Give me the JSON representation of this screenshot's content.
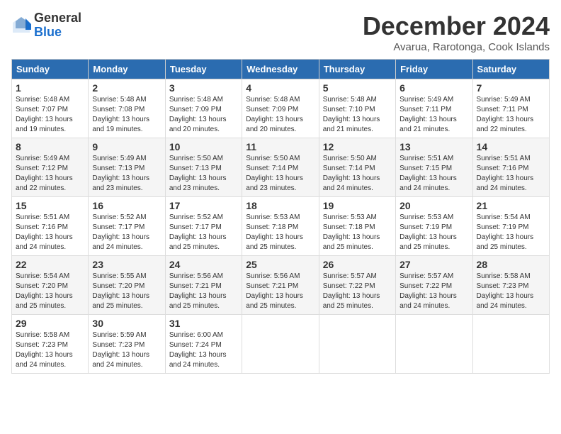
{
  "logo": {
    "general": "General",
    "blue": "Blue"
  },
  "title": "December 2024",
  "subtitle": "Avarua, Rarotonga, Cook Islands",
  "headers": [
    "Sunday",
    "Monday",
    "Tuesday",
    "Wednesday",
    "Thursday",
    "Friday",
    "Saturday"
  ],
  "weeks": [
    [
      {
        "day": "1",
        "info": "Sunrise: 5:48 AM\nSunset: 7:07 PM\nDaylight: 13 hours\nand 19 minutes."
      },
      {
        "day": "2",
        "info": "Sunrise: 5:48 AM\nSunset: 7:08 PM\nDaylight: 13 hours\nand 19 minutes."
      },
      {
        "day": "3",
        "info": "Sunrise: 5:48 AM\nSunset: 7:09 PM\nDaylight: 13 hours\nand 20 minutes."
      },
      {
        "day": "4",
        "info": "Sunrise: 5:48 AM\nSunset: 7:09 PM\nDaylight: 13 hours\nand 20 minutes."
      },
      {
        "day": "5",
        "info": "Sunrise: 5:48 AM\nSunset: 7:10 PM\nDaylight: 13 hours\nand 21 minutes."
      },
      {
        "day": "6",
        "info": "Sunrise: 5:49 AM\nSunset: 7:11 PM\nDaylight: 13 hours\nand 21 minutes."
      },
      {
        "day": "7",
        "info": "Sunrise: 5:49 AM\nSunset: 7:11 PM\nDaylight: 13 hours\nand 22 minutes."
      }
    ],
    [
      {
        "day": "8",
        "info": "Sunrise: 5:49 AM\nSunset: 7:12 PM\nDaylight: 13 hours\nand 22 minutes."
      },
      {
        "day": "9",
        "info": "Sunrise: 5:49 AM\nSunset: 7:13 PM\nDaylight: 13 hours\nand 23 minutes."
      },
      {
        "day": "10",
        "info": "Sunrise: 5:50 AM\nSunset: 7:13 PM\nDaylight: 13 hours\nand 23 minutes."
      },
      {
        "day": "11",
        "info": "Sunrise: 5:50 AM\nSunset: 7:14 PM\nDaylight: 13 hours\nand 23 minutes."
      },
      {
        "day": "12",
        "info": "Sunrise: 5:50 AM\nSunset: 7:14 PM\nDaylight: 13 hours\nand 24 minutes."
      },
      {
        "day": "13",
        "info": "Sunrise: 5:51 AM\nSunset: 7:15 PM\nDaylight: 13 hours\nand 24 minutes."
      },
      {
        "day": "14",
        "info": "Sunrise: 5:51 AM\nSunset: 7:16 PM\nDaylight: 13 hours\nand 24 minutes."
      }
    ],
    [
      {
        "day": "15",
        "info": "Sunrise: 5:51 AM\nSunset: 7:16 PM\nDaylight: 13 hours\nand 24 minutes."
      },
      {
        "day": "16",
        "info": "Sunrise: 5:52 AM\nSunset: 7:17 PM\nDaylight: 13 hours\nand 24 minutes."
      },
      {
        "day": "17",
        "info": "Sunrise: 5:52 AM\nSunset: 7:17 PM\nDaylight: 13 hours\nand 25 minutes."
      },
      {
        "day": "18",
        "info": "Sunrise: 5:53 AM\nSunset: 7:18 PM\nDaylight: 13 hours\nand 25 minutes."
      },
      {
        "day": "19",
        "info": "Sunrise: 5:53 AM\nSunset: 7:18 PM\nDaylight: 13 hours\nand 25 minutes."
      },
      {
        "day": "20",
        "info": "Sunrise: 5:53 AM\nSunset: 7:19 PM\nDaylight: 13 hours\nand 25 minutes."
      },
      {
        "day": "21",
        "info": "Sunrise: 5:54 AM\nSunset: 7:19 PM\nDaylight: 13 hours\nand 25 minutes."
      }
    ],
    [
      {
        "day": "22",
        "info": "Sunrise: 5:54 AM\nSunset: 7:20 PM\nDaylight: 13 hours\nand 25 minutes."
      },
      {
        "day": "23",
        "info": "Sunrise: 5:55 AM\nSunset: 7:20 PM\nDaylight: 13 hours\nand 25 minutes."
      },
      {
        "day": "24",
        "info": "Sunrise: 5:56 AM\nSunset: 7:21 PM\nDaylight: 13 hours\nand 25 minutes."
      },
      {
        "day": "25",
        "info": "Sunrise: 5:56 AM\nSunset: 7:21 PM\nDaylight: 13 hours\nand 25 minutes."
      },
      {
        "day": "26",
        "info": "Sunrise: 5:57 AM\nSunset: 7:22 PM\nDaylight: 13 hours\nand 25 minutes."
      },
      {
        "day": "27",
        "info": "Sunrise: 5:57 AM\nSunset: 7:22 PM\nDaylight: 13 hours\nand 24 minutes."
      },
      {
        "day": "28",
        "info": "Sunrise: 5:58 AM\nSunset: 7:23 PM\nDaylight: 13 hours\nand 24 minutes."
      }
    ],
    [
      {
        "day": "29",
        "info": "Sunrise: 5:58 AM\nSunset: 7:23 PM\nDaylight: 13 hours\nand 24 minutes."
      },
      {
        "day": "30",
        "info": "Sunrise: 5:59 AM\nSunset: 7:23 PM\nDaylight: 13 hours\nand 24 minutes."
      },
      {
        "day": "31",
        "info": "Sunrise: 6:00 AM\nSunset: 7:24 PM\nDaylight: 13 hours\nand 24 minutes."
      },
      {
        "day": "",
        "info": ""
      },
      {
        "day": "",
        "info": ""
      },
      {
        "day": "",
        "info": ""
      },
      {
        "day": "",
        "info": ""
      }
    ]
  ]
}
